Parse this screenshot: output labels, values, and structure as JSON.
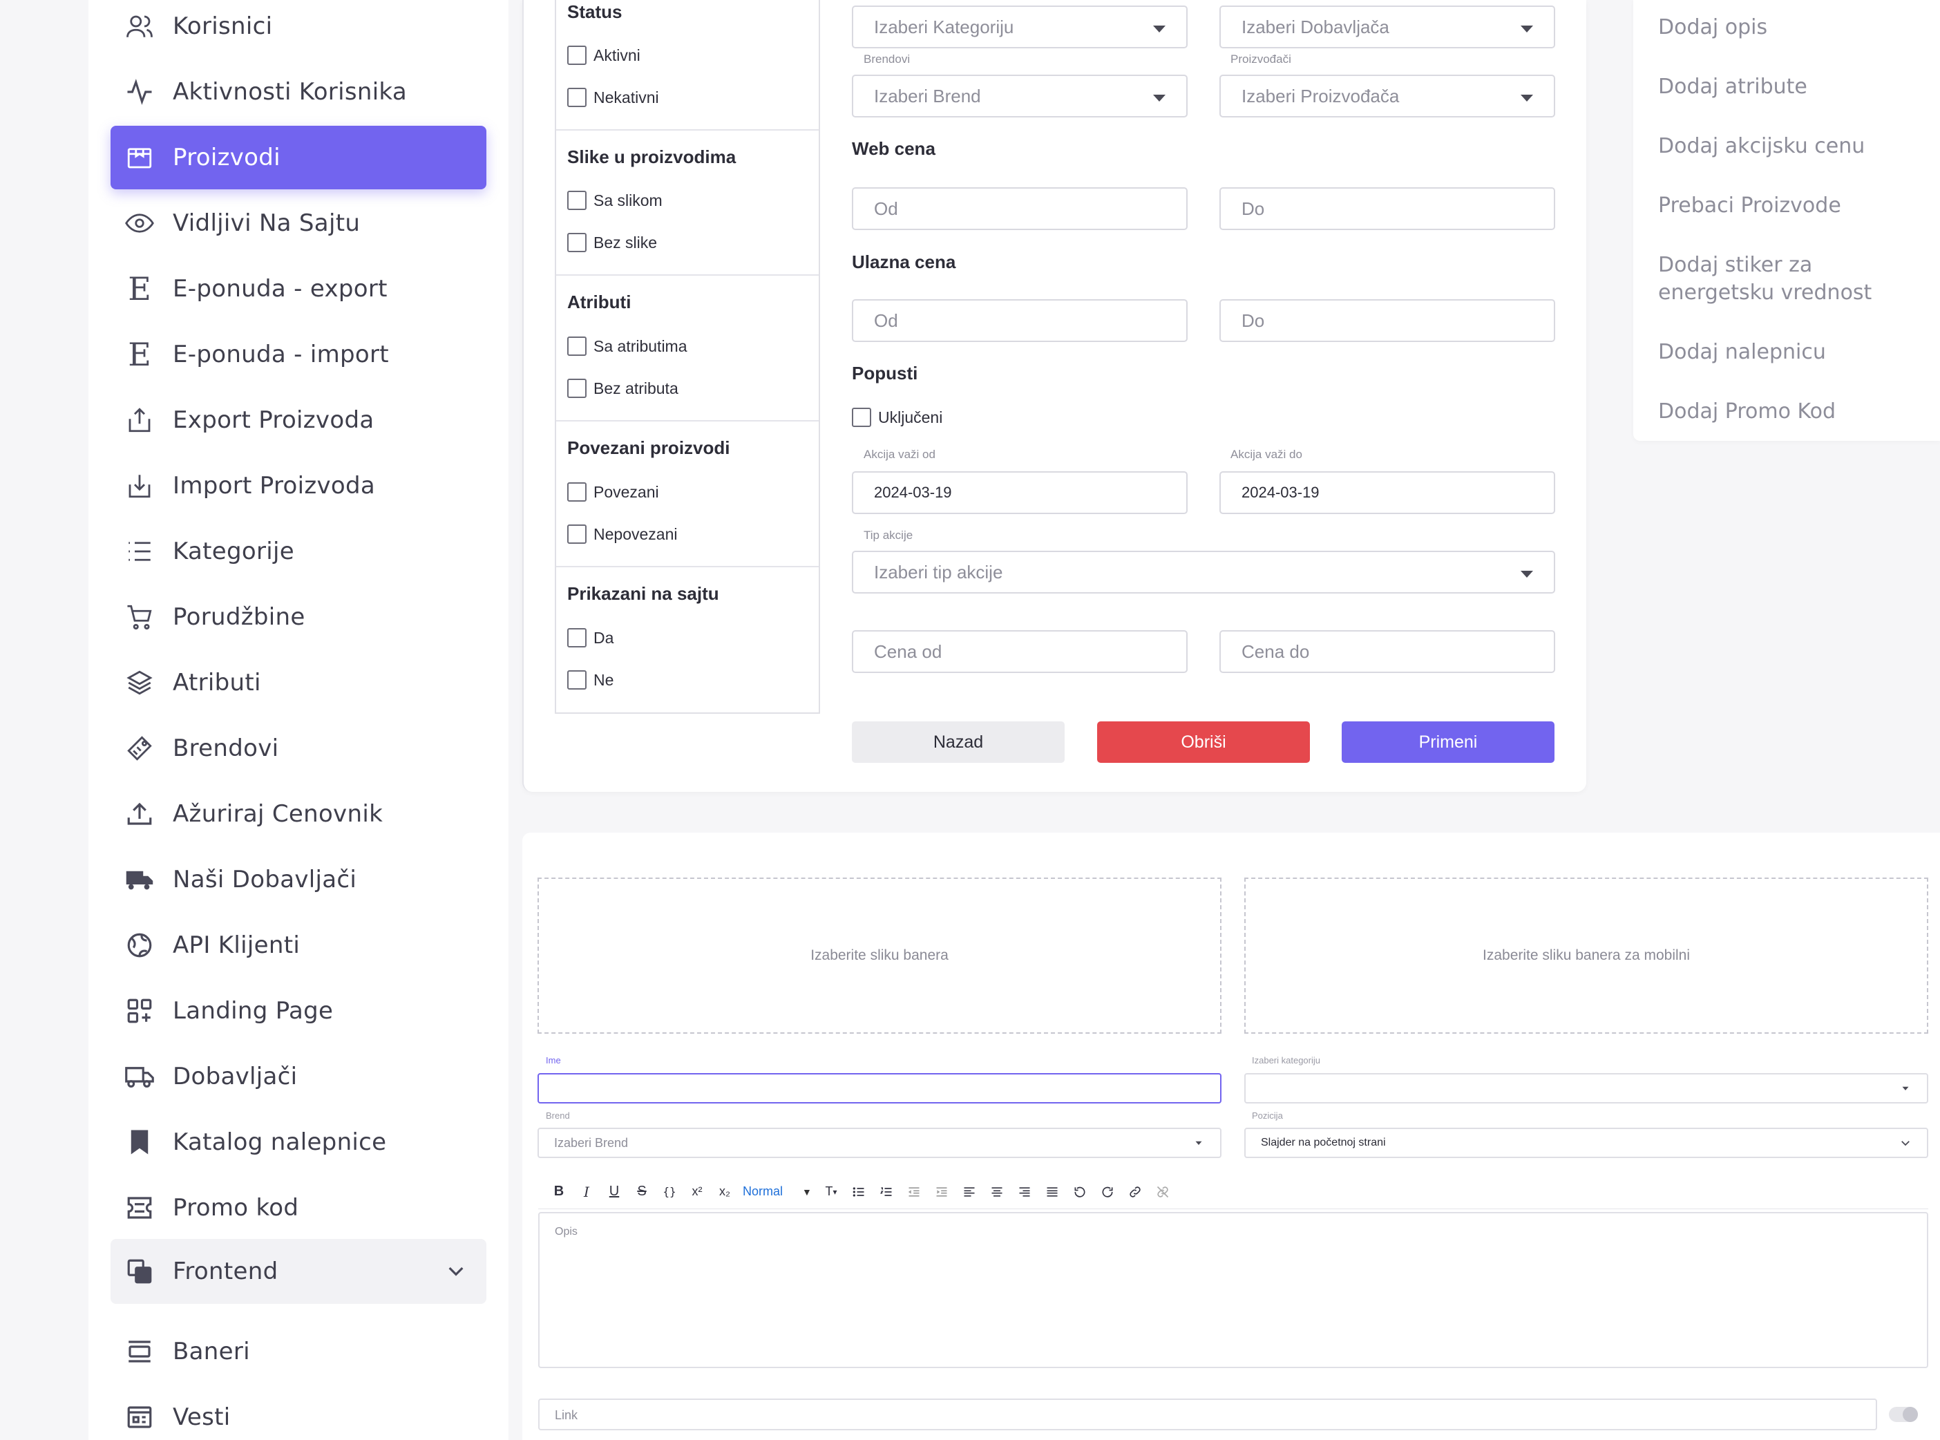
{
  "sidebar": {
    "items": [
      {
        "label": "Korisnici",
        "icon": "users-icon"
      },
      {
        "label": "Aktivnosti Korisnika",
        "icon": "activity-icon"
      },
      {
        "label": "Proizvodi",
        "icon": "box-icon",
        "active": true
      },
      {
        "label": "Vidljivi Na Sajtu",
        "icon": "eye-icon"
      },
      {
        "label": "E-ponuda - export",
        "icon": "e-letter-icon"
      },
      {
        "label": "E-ponuda - import",
        "icon": "e-letter-icon"
      },
      {
        "label": "Export Proizvoda",
        "icon": "export-icon"
      },
      {
        "label": "Import Proizvoda",
        "icon": "import-icon"
      },
      {
        "label": "Kategorije",
        "icon": "list-icon"
      },
      {
        "label": "Porudžbine",
        "icon": "cart-icon"
      },
      {
        "label": "Atributi",
        "icon": "layers-icon"
      },
      {
        "label": "Brendovi",
        "icon": "tag-icon"
      },
      {
        "label": "Ažuriraj Cenovnik",
        "icon": "upload-icon"
      },
      {
        "label": "Naši Dobavljači",
        "icon": "truck-filled-icon"
      },
      {
        "label": "API Klijenti",
        "icon": "globe-icon"
      },
      {
        "label": "Landing Page",
        "icon": "apps-icon"
      },
      {
        "label": "Dobavljači",
        "icon": "truck-icon"
      },
      {
        "label": "Katalog nalepnice",
        "icon": "bookmark-icon"
      },
      {
        "label": "Promo kod",
        "icon": "ticket-icon"
      },
      {
        "label": "Frontend",
        "icon": "copy-icon",
        "group": true
      },
      {
        "label": "Baneri",
        "icon": "banner-icon"
      },
      {
        "label": "Vesti",
        "icon": "news-icon"
      }
    ]
  },
  "filters": {
    "status": {
      "title": "Status",
      "options": [
        "Aktivni",
        "Nekativni"
      ]
    },
    "images": {
      "title": "Slike u proizvodima",
      "options": [
        "Sa slikom",
        "Bez slike"
      ]
    },
    "attributes": {
      "title": "Atributi",
      "options": [
        "Sa atributima",
        "Bez atributa"
      ]
    },
    "related": {
      "title": "Povezani proizvodi",
      "options": [
        "Povezani",
        "Nepovezani"
      ]
    },
    "shown": {
      "title": "Prikazani na sajtu",
      "options": [
        "Da",
        "Ne"
      ]
    }
  },
  "form": {
    "category_placeholder": "Izaberi Kategoriju",
    "supplier_placeholder": "Izaberi Dobavljača",
    "brands_label": "Brendovi",
    "brand_placeholder": "Izaberi Brend",
    "manufacturers_label": "Proizvođači",
    "manufacturer_placeholder": "Izaberi Proizvođača",
    "web_price_title": "Web cena",
    "entry_price_title": "Ulazna cena",
    "from_placeholder": "Od",
    "to_placeholder": "Do",
    "discounts_title": "Popusti",
    "discounts_included": "Uključeni",
    "promo_from_label": "Akcija važi od",
    "promo_from_value": "2024-03-19",
    "promo_to_label": "Akcija važi do",
    "promo_to_value": "2024-03-19",
    "promo_type_label": "Tip akcije",
    "promo_type_placeholder": "Izaberi tip akcije",
    "price_from_placeholder": "Cena od",
    "price_to_placeholder": "Cena do",
    "back_button": "Nazad",
    "delete_button": "Obriši",
    "apply_button": "Primeni"
  },
  "right_menu": {
    "items": [
      "Dodaj opis",
      "Dodaj atribute",
      "Dodaj akcijsku cenu",
      "Prebaci Proizvode",
      "Dodaj stiker za energetsku vrednost",
      "Dodaj nalepnicu",
      "Dodaj Promo Kod"
    ]
  },
  "banner": {
    "dropzone_desktop": "Izaberite sliku banera",
    "dropzone_mobile": "Izaberite sliku banera za mobilni",
    "name_label": "Ime",
    "category_label": "Izaberi kategoriju",
    "brand_label": "Brend",
    "brand_placeholder": "Izaberi Brend",
    "position_label": "Pozicija",
    "position_value": "Slajder na početnoj strani",
    "toolbar_normal": "Normal",
    "description_placeholder": "Opis",
    "link_placeholder": "Link"
  },
  "colors": {
    "accent": "#7264ef",
    "danger": "#e5484d"
  }
}
